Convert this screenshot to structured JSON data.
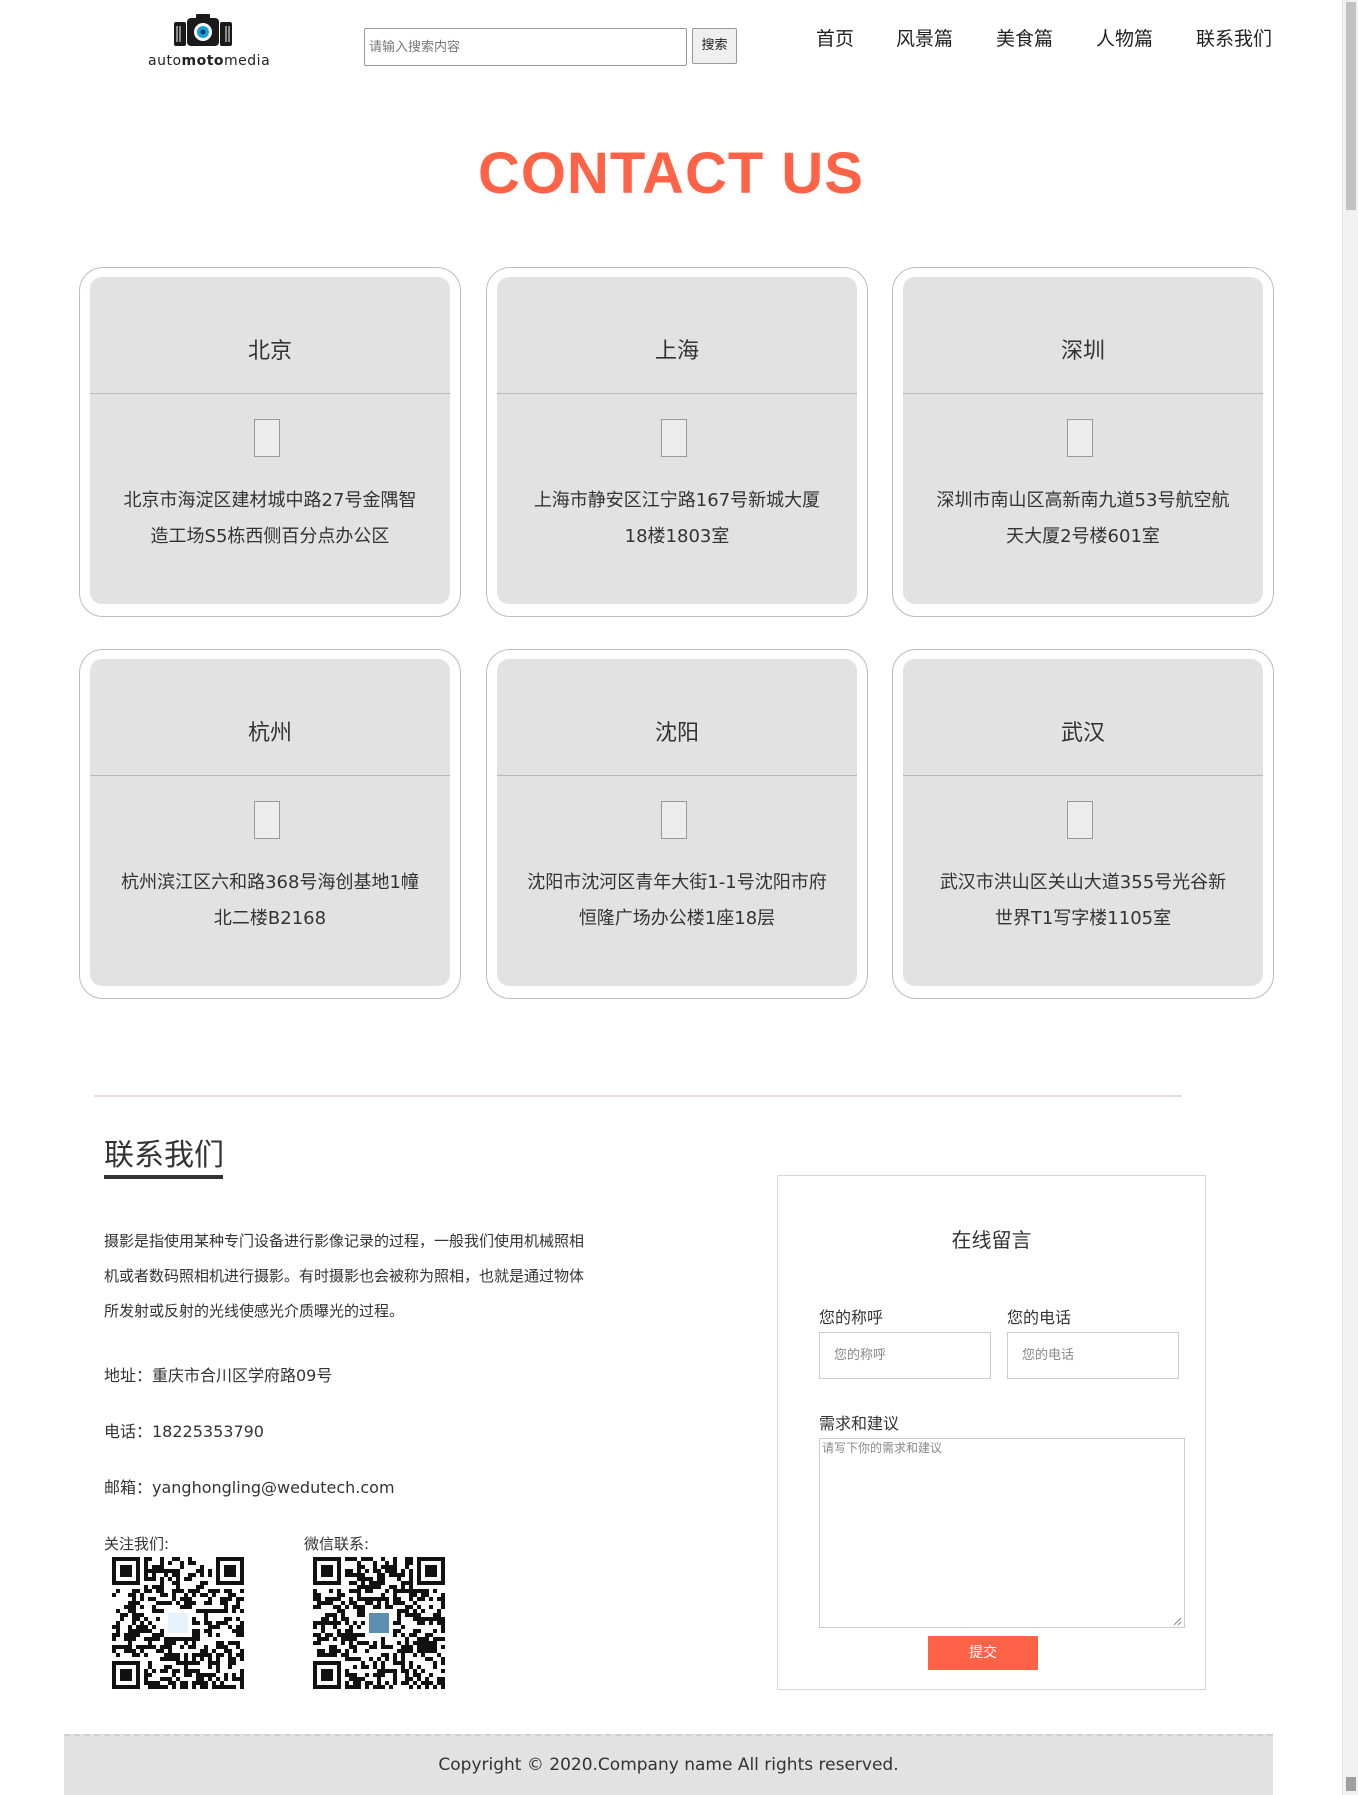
{
  "header": {
    "logo_text_parts": [
      "auto",
      "moto",
      "media"
    ],
    "search": {
      "placeholder": "请输入搜索内容",
      "button_label": "搜索"
    },
    "nav": [
      {
        "label": "首页"
      },
      {
        "label": "风景篇"
      },
      {
        "label": "美食篇"
      },
      {
        "label": "人物篇"
      },
      {
        "label": "联系我们"
      }
    ]
  },
  "page_title": "CONTACT US",
  "offices": [
    {
      "city": "北京",
      "address": "北京市海淀区建材城中路27号金隅智造工场S5栋西侧百分点办公区"
    },
    {
      "city": "上海",
      "address": "上海市静安区江宁路167号新城大厦18楼1803室"
    },
    {
      "city": "深圳",
      "address": "深圳市南山区高新南九道53号航空航天大厦2号楼601室"
    },
    {
      "city": "杭州",
      "address": "杭州滨江区六和路368号海创基地1幢北二楼B2168"
    },
    {
      "city": "沈阳",
      "address": "沈阳市沈河区青年大街1-1号沈阳市府恒隆广场办公楼1座18层"
    },
    {
      "city": "武汉",
      "address": "武汉市洪山区关山大道355号光谷新世界T1写字楼1105室"
    }
  ],
  "contact": {
    "heading": "联系我们",
    "intro": "摄影是指使用某种专门设备进行影像记录的过程，一般我们使用机械照相机或者数码照相机进行摄影。有时摄影也会被称为照相，也就是通过物体所发射或反射的光线使感光介质曝光的过程。",
    "address": "地址：重庆市合川区学府路09号",
    "phone": "电话：18225353790",
    "email": "邮箱：yanghongling@wedutech.com",
    "follow_label": "关注我们:",
    "wechat_label": "微信联系:"
  },
  "message_form": {
    "title": "在线留言",
    "name_label": "您的称呼",
    "name_placeholder": "您的称呼",
    "phone_label": "您的电话",
    "phone_placeholder": "您的电话",
    "suggestion_label": "需求和建议",
    "suggestion_placeholder": "请写下你的需求和建议",
    "submit_label": "提交"
  },
  "footer": {
    "copyright": "Copyright © 2020.Company name All rights reserved."
  },
  "colors": {
    "accent": "#ff6347",
    "card_bg": "#e2e2e2",
    "footer_bg": "#e2e2e2"
  }
}
